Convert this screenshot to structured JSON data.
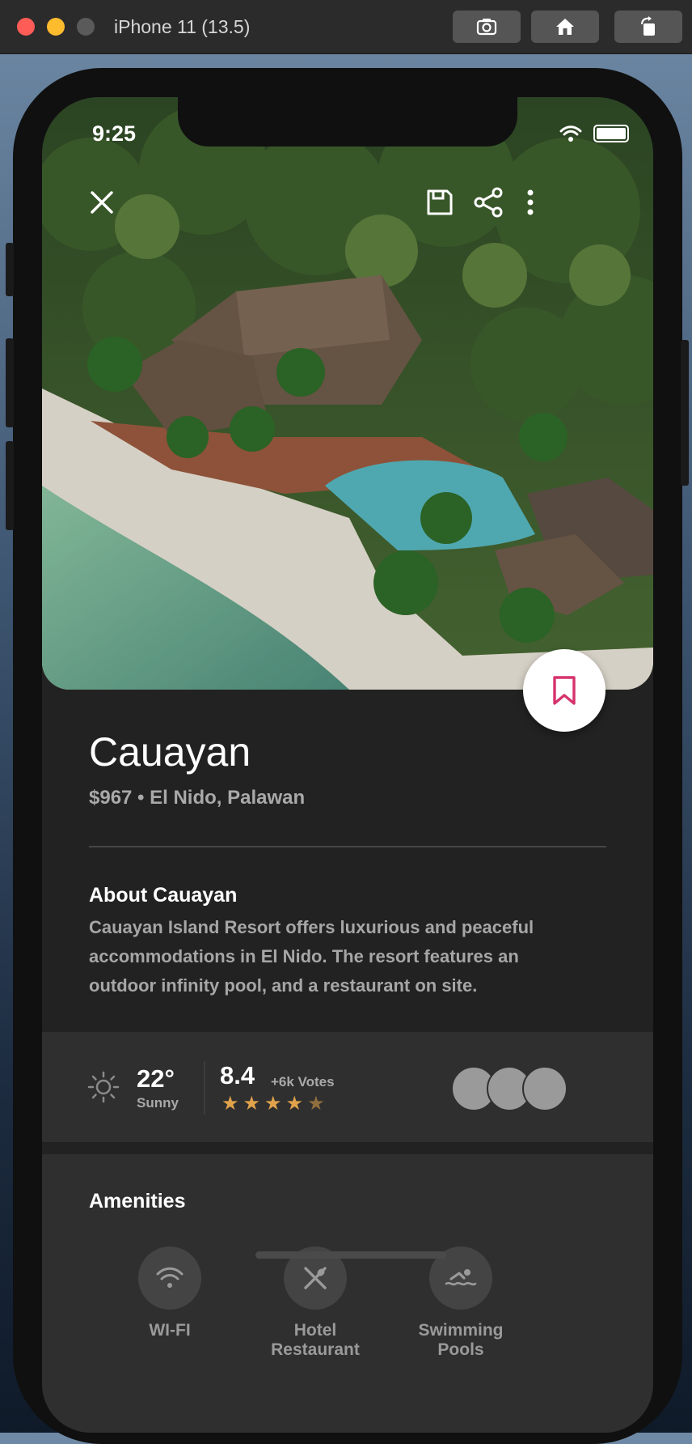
{
  "simulator": {
    "title": "iPhone 11 (13.5)",
    "toolbar_icons": [
      "screenshot-icon",
      "home-icon",
      "rotate-icon"
    ]
  },
  "status_bar": {
    "time": "9:25",
    "icons": [
      "wifi-icon",
      "battery-icon"
    ]
  },
  "hero": {
    "image": "aerial view of beach resort with pool and palm trees",
    "actions": [
      "close-icon",
      "save-icon",
      "share-icon",
      "more-icon"
    ],
    "bookmark_color": "#d6336c"
  },
  "place": {
    "title": "Cauayan",
    "subtitle": "$967 • El Nido, Palawan"
  },
  "about": {
    "heading": "About Cauayan",
    "text": "Cauayan Island Resort offers luxurious and peaceful accommodations in El Nido. The resort features an outdoor infinity pool, and a restaurant on site."
  },
  "stats": {
    "temperature": "22°",
    "weather": "Sunny",
    "rating": "8.4",
    "votes": "+6k Votes",
    "stars": 4.5,
    "star_color": "#e0a24b",
    "avatar_count": 3
  },
  "amenities": {
    "heading": "Amenities",
    "items": [
      {
        "icon": "wifi-icon",
        "label": "WI-FI"
      },
      {
        "icon": "restaurant-icon",
        "label": "Hotel Restaurant"
      },
      {
        "icon": "swimming-icon",
        "label": "Swimming Pools"
      }
    ]
  }
}
